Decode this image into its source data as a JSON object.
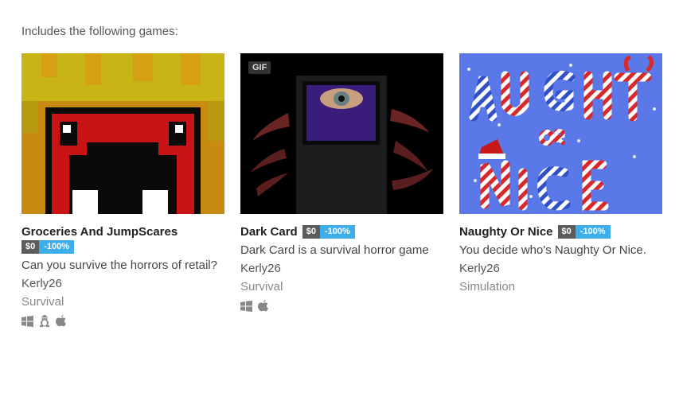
{
  "intro_text": "Includes the following games:",
  "games": [
    {
      "title": "Groceries And JumpScares",
      "price": "$0",
      "discount": "-100%",
      "description": "Can you survive the horrors of retail?",
      "author": "Kerly26",
      "genre": "Survival",
      "platforms": [
        "windows-icon",
        "linux-icon",
        "apple-icon"
      ]
    },
    {
      "title": "Dark Card",
      "badge": "GIF",
      "price": "$0",
      "discount": "-100%",
      "description": "Dark Card is a survival horror game",
      "author": "Kerly26",
      "genre": "Survival",
      "platforms": [
        "windows-icon",
        "apple-icon"
      ]
    },
    {
      "title": "Naughty Or Nice",
      "price": "$0",
      "discount": "-100%",
      "description": "You decide who's Naughty Or Nice.",
      "author": "Kerly26",
      "genre": "Simulation",
      "platforms": []
    }
  ],
  "colors": {
    "discount_blue": "#3daee9",
    "price_gray": "#5c5c5c"
  }
}
